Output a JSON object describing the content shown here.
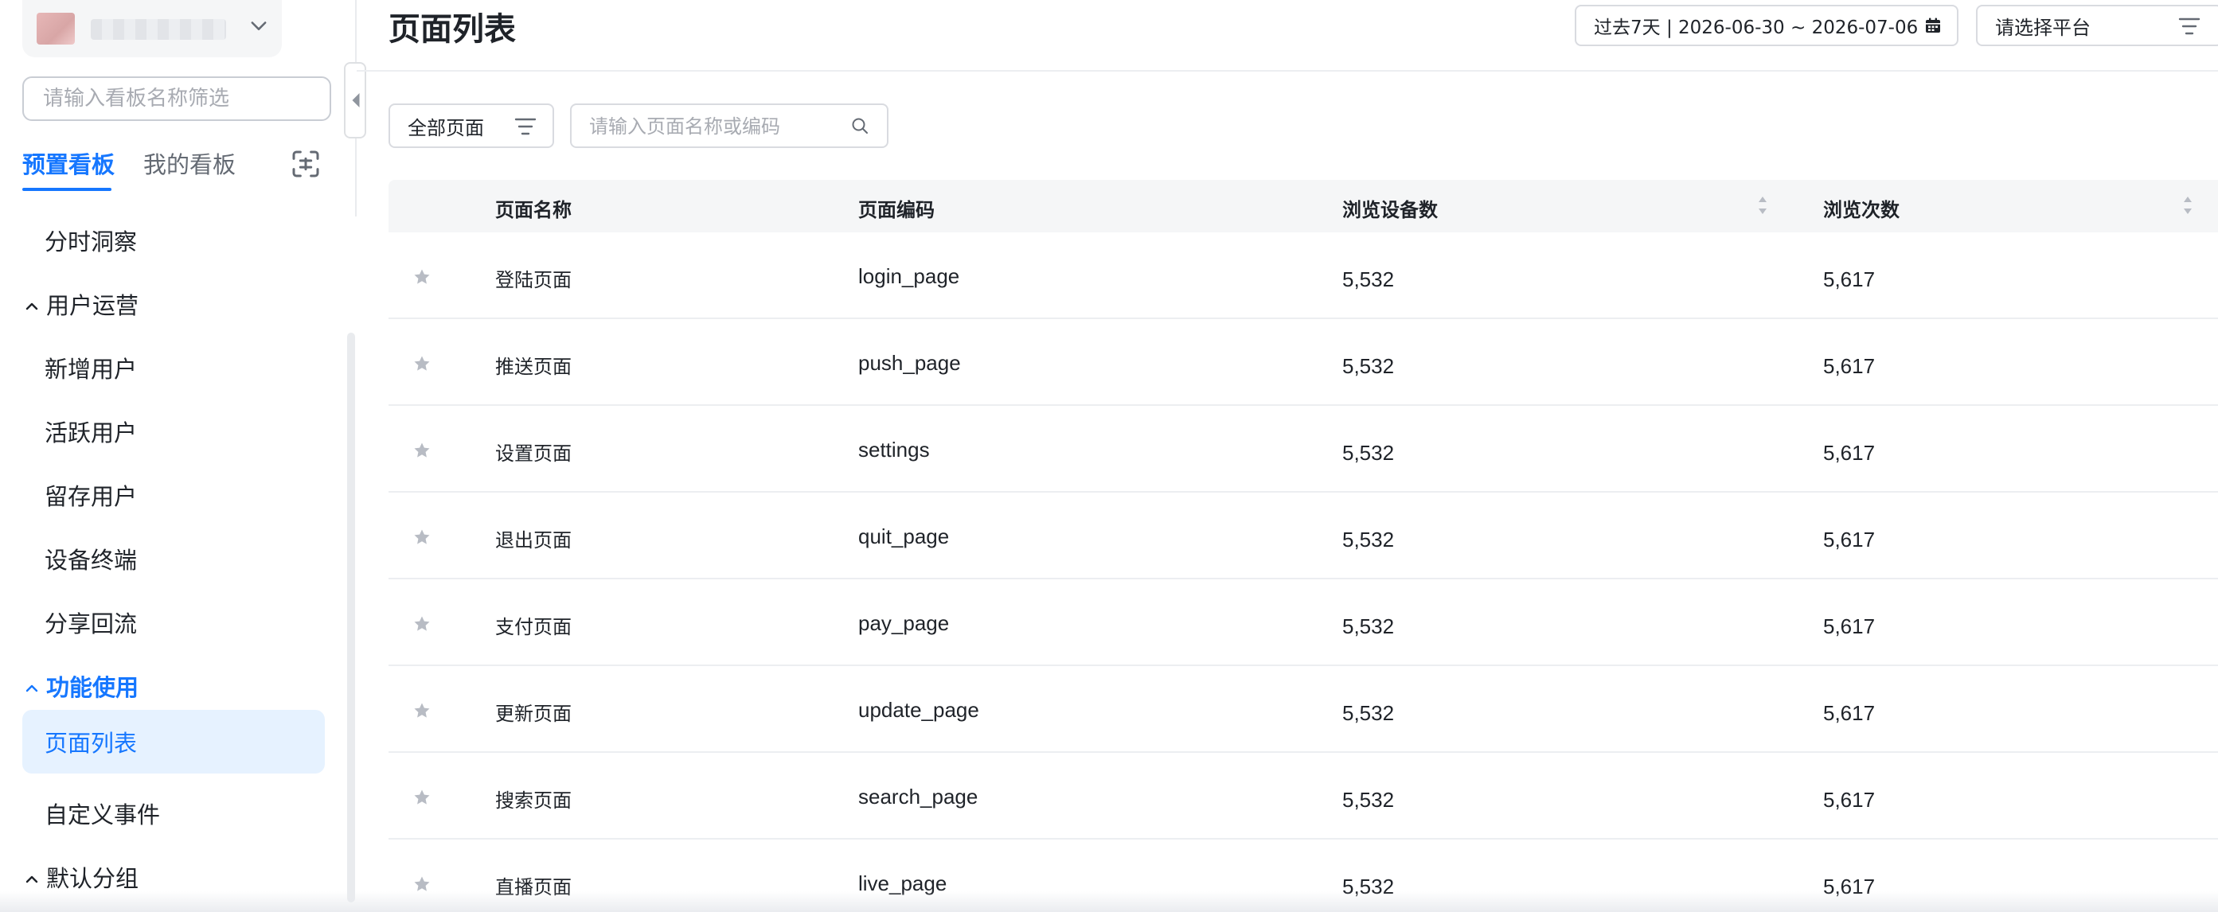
{
  "sidebar": {
    "board_filter_placeholder": "请输入看板名称筛选",
    "tabs": [
      {
        "label": "预置看板",
        "active": true
      },
      {
        "label": "我的看板",
        "active": false
      }
    ],
    "menu": [
      {
        "label": "分时洞察",
        "type": "sub"
      },
      {
        "label": "用户运营",
        "type": "group"
      },
      {
        "label": "新增用户",
        "type": "sub"
      },
      {
        "label": "活跃用户",
        "type": "sub"
      },
      {
        "label": "留存用户",
        "type": "sub"
      },
      {
        "label": "设备终端",
        "type": "sub"
      },
      {
        "label": "分享回流",
        "type": "sub"
      },
      {
        "label": "功能使用",
        "type": "group-active"
      },
      {
        "label": "页面列表",
        "type": "sub-selected"
      },
      {
        "label": "自定义事件",
        "type": "sub"
      },
      {
        "label": "默认分组",
        "type": "group"
      }
    ]
  },
  "header": {
    "title": "页面列表",
    "date_range": "过去7天 | 2026-06-30 ~ 2026-07-06",
    "platform_placeholder": "请选择平台"
  },
  "toolbar": {
    "page_filter_label": "全部页面",
    "search_placeholder": "请输入页面名称或编码"
  },
  "table": {
    "columns": [
      "页面名称",
      "页面编码",
      "浏览设备数",
      "浏览次数"
    ],
    "rows": [
      {
        "name": "登陆页面",
        "code": "login_page",
        "devices": "5,532",
        "views": "5,617"
      },
      {
        "name": "推送页面",
        "code": "push_page",
        "devices": "5,532",
        "views": "5,617"
      },
      {
        "name": "设置页面",
        "code": "settings",
        "devices": "5,532",
        "views": "5,617"
      },
      {
        "name": "退出页面",
        "code": "quit_page",
        "devices": "5,532",
        "views": "5,617"
      },
      {
        "name": "支付页面",
        "code": "pay_page",
        "devices": "5,532",
        "views": "5,617"
      },
      {
        "name": "更新页面",
        "code": "update_page",
        "devices": "5,532",
        "views": "5,617"
      },
      {
        "name": "搜索页面",
        "code": "search_page",
        "devices": "5,532",
        "views": "5,617"
      },
      {
        "name": "直播页面",
        "code": "live_page",
        "devices": "5,532",
        "views": "5,617"
      }
    ]
  },
  "colors": {
    "accent": "#1677ff",
    "selected_bg": "#e6f2ff",
    "star": "#b8bcc4"
  },
  "icons": {
    "account_toggle": "chevron-down-icon",
    "scan": "scan-icon",
    "calendar": "calendar-icon",
    "filter": "filter-icon",
    "search": "search-icon",
    "star": "star-icon",
    "sort": "sort-icon",
    "collapse": "chevron-left-icon"
  }
}
